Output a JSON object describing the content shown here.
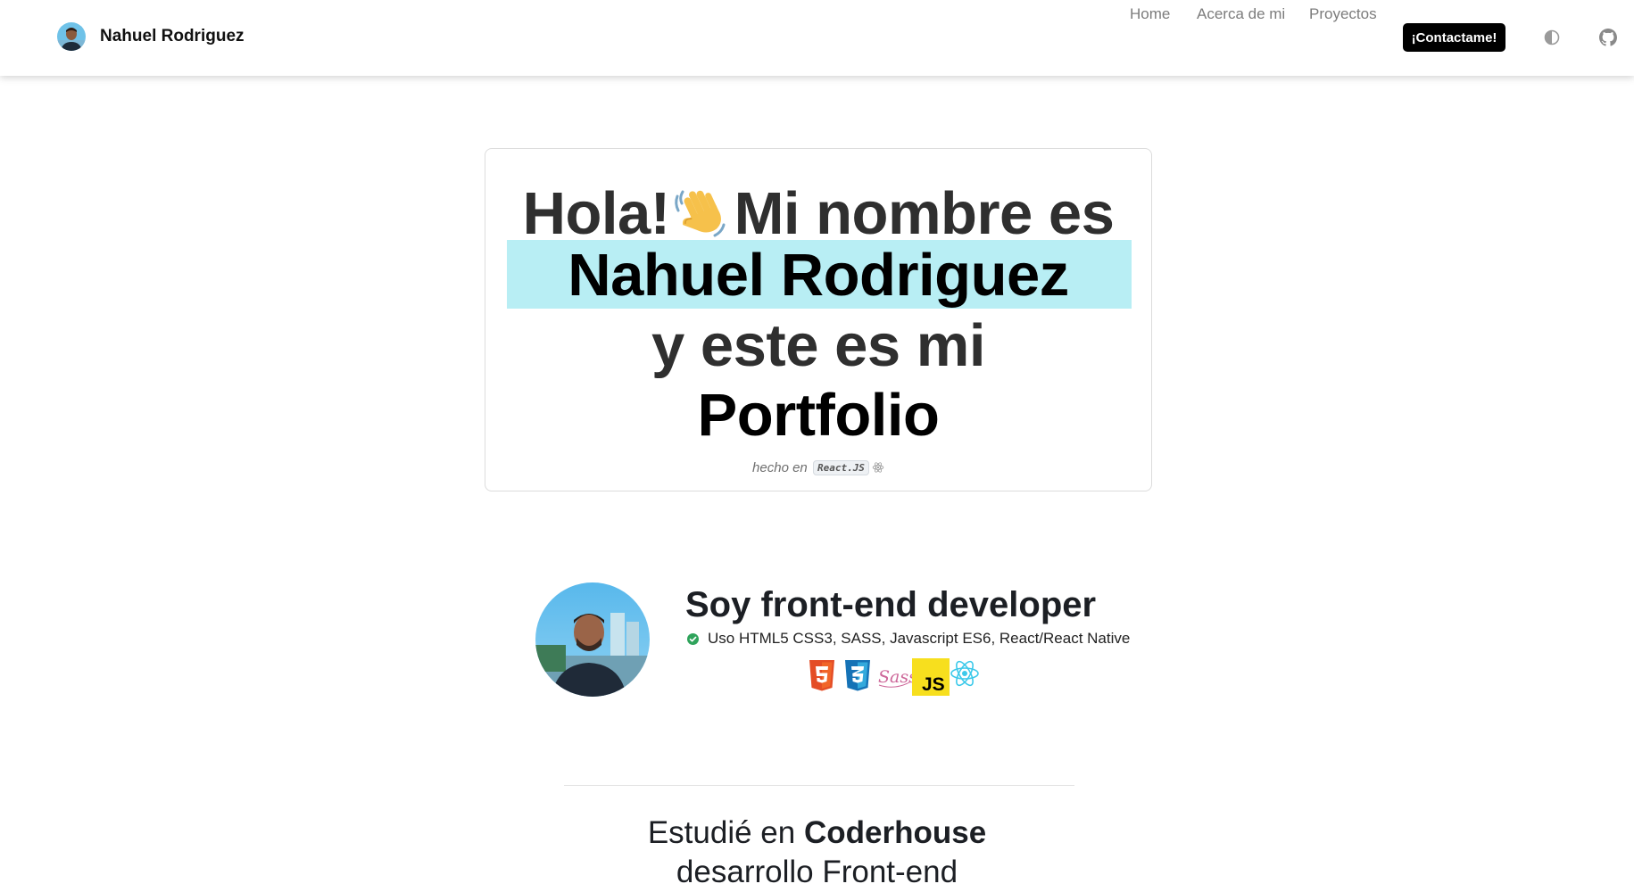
{
  "navbar": {
    "brand_name": "Nahuel Rodriguez",
    "links": [
      "Home",
      "Acerca de mi",
      "Proyectos"
    ],
    "contact_label": "¡Contactame!"
  },
  "hero": {
    "line1_a": "Hola!",
    "line1_b": "Mi nombre es",
    "name": "Nahuel Rodriguez",
    "line3": "y este es mi",
    "line4": "Portfolio",
    "made_with_prefix": "hecho en",
    "made_with_tech": "React.JS",
    "highlight_color": "#b8eef4"
  },
  "about": {
    "title": "Soy front-end developer",
    "skills": "Uso HTML5 CSS3, SASS, Javascript ES6, React/React Native",
    "tech_icons": [
      "html5-icon",
      "css3-icon",
      "sass-icon",
      "javascript-icon",
      "react-icon"
    ]
  },
  "studies": {
    "prefix": "Estudié en",
    "school": "Coderhouse",
    "line2": "desarrollo Front-end"
  },
  "colors": {
    "accent_button": "#000000",
    "text_dark": "#2f2f2f",
    "nav_link": "#7c7c7c"
  }
}
